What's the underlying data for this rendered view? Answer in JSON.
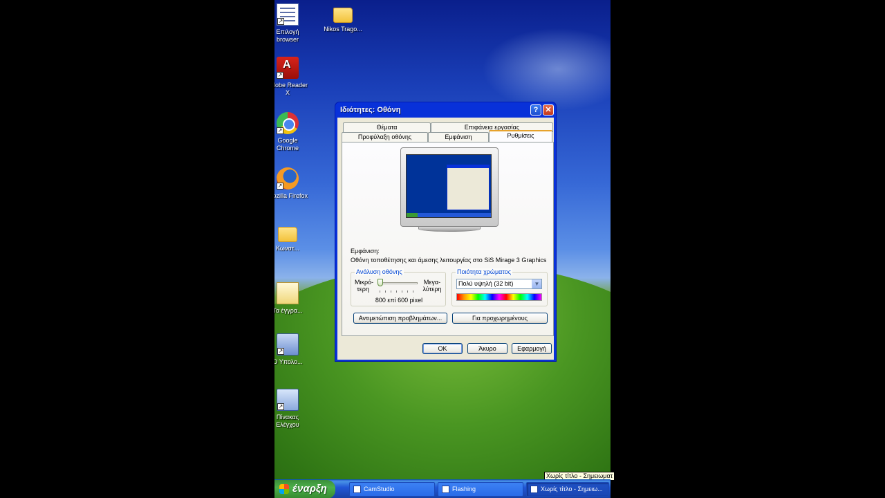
{
  "desktop": {
    "icons": [
      {
        "label": "Επιλογή browser",
        "icon": "checklist-icon"
      },
      {
        "label": "Nikos Trago...",
        "icon": "folder-icon"
      },
      {
        "label": "Adobe Reader X",
        "icon": "pdf-icon"
      },
      {
        "label": "Google Chrome",
        "icon": "chrome-icon"
      },
      {
        "label": "Mozilla Firefox",
        "icon": "firefox-icon"
      },
      {
        "label": "Κωνστ...",
        "icon": "folder-icon"
      },
      {
        "label": "Τα έγγρα...",
        "icon": "documents-icon"
      },
      {
        "label": "Ο Υπολο...",
        "icon": "computer-icon"
      },
      {
        "label": "Πίνακας Ελέγχου",
        "icon": "control-panel-icon"
      }
    ]
  },
  "dialog": {
    "title": "Ιδιότητες: Οθόνη",
    "tabs_row1": [
      "Θέματα",
      "Επιφάνεια εργασίας"
    ],
    "tabs_row2": [
      "Προφύλαξη οθόνης",
      "Εμφάνιση",
      "Ρυθμίσεις"
    ],
    "active_tab": "Ρυθμίσεις",
    "display_label": "Εμφάνιση:",
    "display_value": "Οθόνη τοποθέτησης και άμεσης λειτουργίας στο SiS Mirage 3 Graphics",
    "resolution": {
      "legend": "Ανάλυση οθόνης",
      "less": "Μικρό-\nτερη",
      "more": "Μεγα-\nλύτερη",
      "value": "800 επί 600 pixel",
      "position": 0.0
    },
    "color_quality": {
      "legend": "Ποιότητα χρώματος",
      "selected": "Πολύ υψηλή (32 bit)"
    },
    "buttons": {
      "troubleshoot": "Αντιμετώπιση προβλημάτων...",
      "advanced": "Για προχωρημένους",
      "ok": "OK",
      "cancel": "Άκυρο",
      "apply": "Εφαρμογή"
    }
  },
  "taskbar": {
    "start_label": "έναρξη",
    "tasks": [
      "CamStudio",
      "Flashing",
      "Χωρίς τίτλο - Σημειω..."
    ],
    "tooltip": "Χωρίς τίτλο - Σημειωματ"
  },
  "colors": {
    "titlebar": "#0831d9",
    "dialog_bg": "#ece9d8",
    "taskbar": "#2157d7",
    "start": "#3c8f3a",
    "group_legend": "#0046d5"
  }
}
